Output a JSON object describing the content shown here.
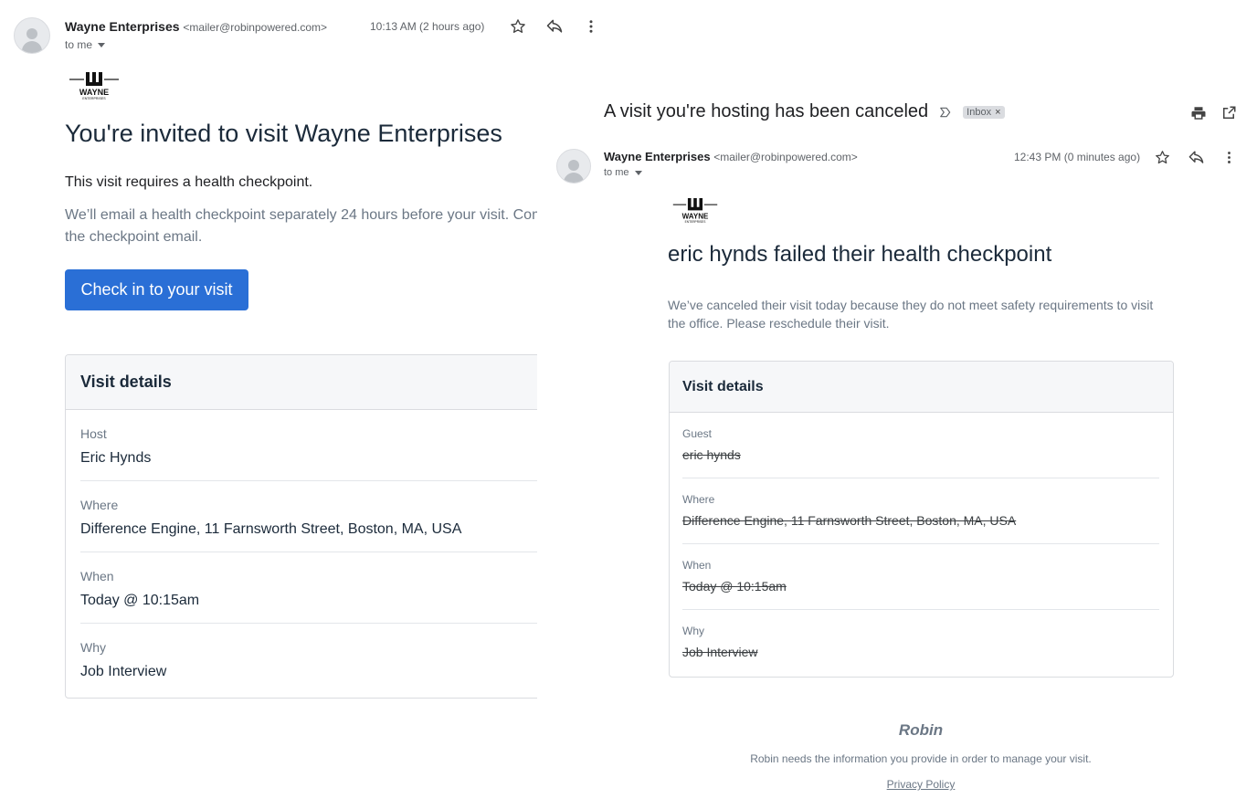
{
  "left_email": {
    "sender_name": "Wayne Enterprises",
    "sender_email": "<mailer@robinpowered.com>",
    "to": "to me",
    "timestamp": "10:13 AM (2 hours ago)",
    "logo_text": "WAYNE",
    "logo_subtext": "ENTERPRISES",
    "title": "You're invited to visit Wayne Enterprises",
    "requirement": "This visit requires a health checkpoint.",
    "paragraph": "We’ll email a health checkpoint separately 24 hours before your visit. Com by following the link in the checkpoint email.",
    "checkin_button": "Check in to your visit",
    "card": {
      "heading": "Visit details",
      "rows": [
        {
          "label": "Host",
          "value": "Eric Hynds"
        },
        {
          "label": "Where",
          "value": "Difference Engine, 11 Farnsworth Street, Boston, MA, USA"
        },
        {
          "label": "When",
          "value": "Today @ 10:15am"
        },
        {
          "label": "Why",
          "value": "Job Interview"
        }
      ]
    }
  },
  "right_email": {
    "subject": "A visit you're hosting has been canceled",
    "label": "Inbox",
    "label_close": "×",
    "sender_name": "Wayne Enterprises",
    "sender_email": "<mailer@robinpowered.com>",
    "to": "to me",
    "timestamp": "12:43 PM (0 minutes ago)",
    "logo_text": "WAYNE",
    "logo_subtext": "ENTERPRISES",
    "title": "eric hynds failed their health checkpoint",
    "paragraph": "We’ve canceled their visit today because they do not meet safety requirements to visit the office. Please reschedule their visit.",
    "card": {
      "heading": "Visit details",
      "rows": [
        {
          "label": "Guest",
          "value": "eric hynds"
        },
        {
          "label": "Where",
          "value": "Difference Engine, 11 Farnsworth Street, Boston, MA, USA"
        },
        {
          "label": "When",
          "value": "Today @ 10:15am"
        },
        {
          "label": "Why",
          "value": "Job Interview"
        }
      ]
    },
    "footer_brand": "Robin",
    "footer_text": "Robin needs the information you provide in order to manage your visit.",
    "privacy_link": "Privacy Policy"
  },
  "icons": {
    "star": "star-icon",
    "reply": "reply-icon",
    "more": "more-vert-icon",
    "print": "print-icon",
    "open_new": "open-in-new-icon",
    "important": "important-marker-icon"
  },
  "colors": {
    "primary_button": "#2a6fd6",
    "card_header_bg": "#f6f7f9",
    "muted_text": "#6b7785"
  }
}
